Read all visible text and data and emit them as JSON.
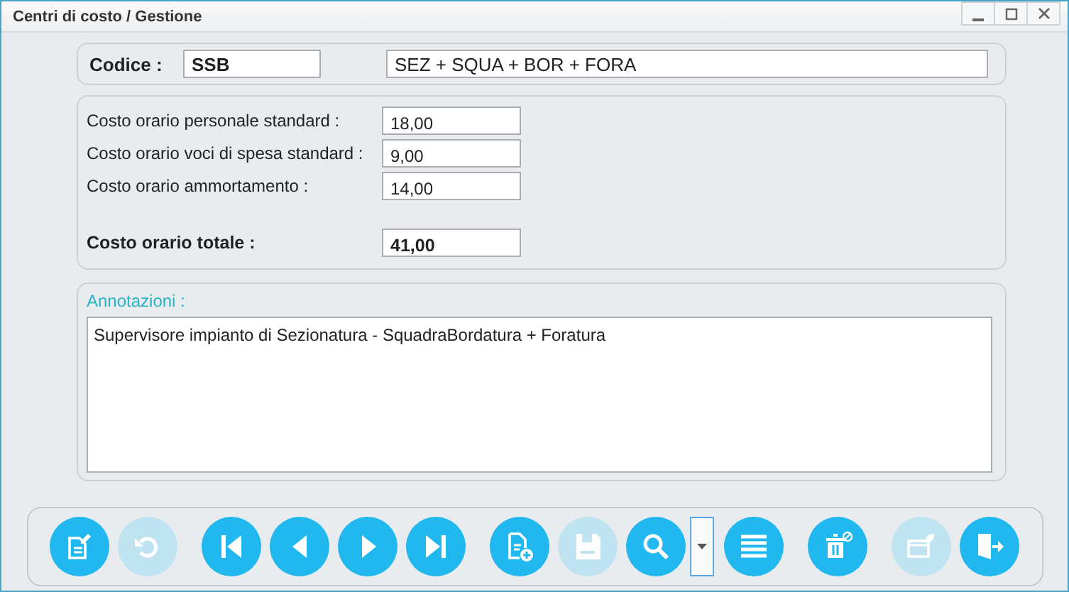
{
  "window": {
    "title": "Centri di costo / Gestione"
  },
  "header": {
    "code_label": "Codice :",
    "code": "SSB",
    "description": "SEZ + SQUA + BOR + FORA"
  },
  "costs": [
    {
      "label": "Costo orario personale standard :",
      "value": "18,00"
    },
    {
      "label": "Costo orario voci di spesa standard :",
      "value": "9,00"
    },
    {
      "label": "Costo orario ammortamento :",
      "value": "14,00"
    }
  ],
  "total": {
    "label": "Costo orario totale :",
    "value": "41,00"
  },
  "notes": {
    "label": "Annotazioni :",
    "value": "Supervisore impianto di Sezionatura - SquadraBordatura + Foratura"
  },
  "toolbar": {
    "groups": [
      [
        {
          "kind": "edit",
          "disabled": false
        },
        {
          "kind": "undo",
          "disabled": true
        }
      ],
      [
        {
          "kind": "first",
          "disabled": false
        },
        {
          "kind": "prev",
          "disabled": false
        },
        {
          "kind": "next",
          "disabled": false
        },
        {
          "kind": "last",
          "disabled": false
        }
      ],
      [
        {
          "kind": "new",
          "disabled": false
        },
        {
          "kind": "save",
          "disabled": true
        },
        {
          "kind": "search",
          "disabled": false
        },
        {
          "kind": "dropdown",
          "disabled": false
        },
        {
          "kind": "list",
          "disabled": false
        }
      ],
      [
        {
          "kind": "delete",
          "disabled": false
        }
      ],
      [
        {
          "kind": "export",
          "disabled": true
        },
        {
          "kind": "exit",
          "disabled": false
        }
      ]
    ]
  }
}
